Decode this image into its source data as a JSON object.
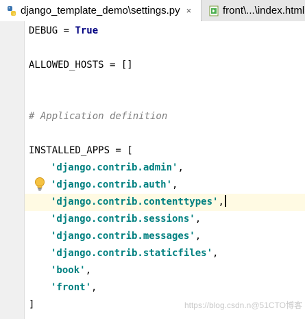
{
  "tabs": [
    {
      "label": "django_template_demo\\settings.py",
      "close": "×",
      "icon": "python-file-icon",
      "active": true
    },
    {
      "label": "front\\...\\index.html",
      "icon": "html-file-icon",
      "active": false
    }
  ],
  "code": {
    "debug": {
      "name": "DEBUG",
      "op": " = ",
      "value": "True"
    },
    "allowed_hosts": "ALLOWED_HOSTS = []",
    "comment": "# Application definition",
    "installed_apps_open": "INSTALLED_APPS = [",
    "apps": [
      "'django.contrib.admin'",
      "'django.contrib.auth'",
      "'django.contrib.contenttypes'",
      "'django.contrib.sessions'",
      "'django.contrib.messages'",
      "'django.contrib.staticfiles'",
      "'book'",
      "'front'"
    ],
    "separator": ",",
    "installed_apps_close": "]"
  },
  "intention_icon": "lightbulb-icon",
  "watermark": "https://blog.csdn.n@51CTO博客",
  "colors": {
    "keyword": "#000080",
    "string": "#008080",
    "comment": "#808080",
    "current_line": "#fffae3",
    "tabbar": "#e6e6e6"
  }
}
